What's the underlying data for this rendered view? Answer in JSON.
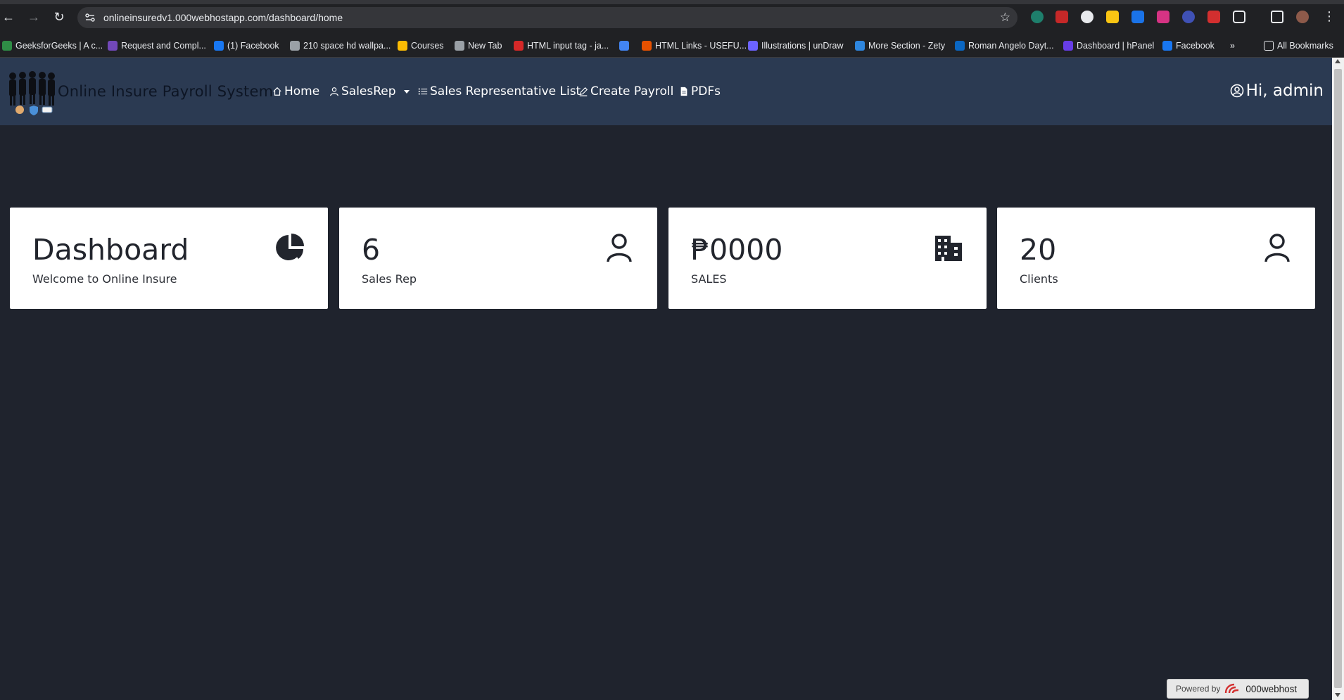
{
  "browser": {
    "url": "onlineinsuredv1.000webhostapp.com/dashboard/home",
    "bookmarks": [
      {
        "label": "GeeksforGeeks | A c...",
        "icon": "geeksforgeeks-icon",
        "color": "#2f8d46"
      },
      {
        "label": "Request and Compl...",
        "icon": "form-icon",
        "color": "#7248b9"
      },
      {
        "label": "(1) Facebook",
        "icon": "facebook-icon",
        "color": "#1877f2"
      },
      {
        "label": "210 space hd wallpa...",
        "icon": "globe-icon",
        "color": "#9aa0a6"
      },
      {
        "label": "Courses",
        "icon": "courses-icon",
        "color": "#fbbc04"
      },
      {
        "label": "New Tab",
        "icon": "globe-icon",
        "color": "#9aa0a6"
      },
      {
        "label": "HTML input tag - ja...",
        "icon": "javatpoint-icon",
        "color": "#d62828"
      },
      {
        "label": "",
        "icon": "doc-icon",
        "color": "#4285f4"
      },
      {
        "label": "HTML Links - USEFU...",
        "icon": "html-links-icon",
        "color": "#e65100"
      },
      {
        "label": "Illustrations | unDraw",
        "icon": "undraw-icon",
        "color": "#6c63ff"
      },
      {
        "label": "More Section - Zety",
        "icon": "zety-icon",
        "color": "#2e86de"
      },
      {
        "label": "Roman Angelo Dayt...",
        "icon": "linkedin-icon",
        "color": "#0a66c2"
      },
      {
        "label": "Dashboard | hPanel",
        "icon": "hostinger-icon",
        "color": "#673de6"
      },
      {
        "label": "Facebook",
        "icon": "facebook-icon",
        "color": "#1877f2"
      }
    ],
    "more_bookmarks": "»",
    "all_bookmarks": "All Bookmarks"
  },
  "navbar": {
    "brand": "Online Insure Payroll System",
    "links": {
      "home": "Home",
      "salesrep": "SalesRep",
      "list": "Sales Representative List",
      "payroll": "Create Payroll",
      "pdfs": "PDFs"
    },
    "greeting": "Hi, admin"
  },
  "cards": [
    {
      "value": "Dashboard",
      "label": "Welcome to Online Insure",
      "icon": "pie-chart-icon"
    },
    {
      "value": "6",
      "label": "Sales Rep",
      "icon": "person-icon"
    },
    {
      "value": "₱0000",
      "label": "SALES",
      "icon": "building-icon"
    },
    {
      "value": "20",
      "label": "Clients",
      "icon": "person-icon"
    }
  ],
  "footer": {
    "powered_by": "Powered by",
    "host": "000webhost"
  },
  "colors": {
    "page_bg": "#1f232d",
    "navbar_bg": "#2b3a52",
    "card_bg": "#ffffff"
  }
}
